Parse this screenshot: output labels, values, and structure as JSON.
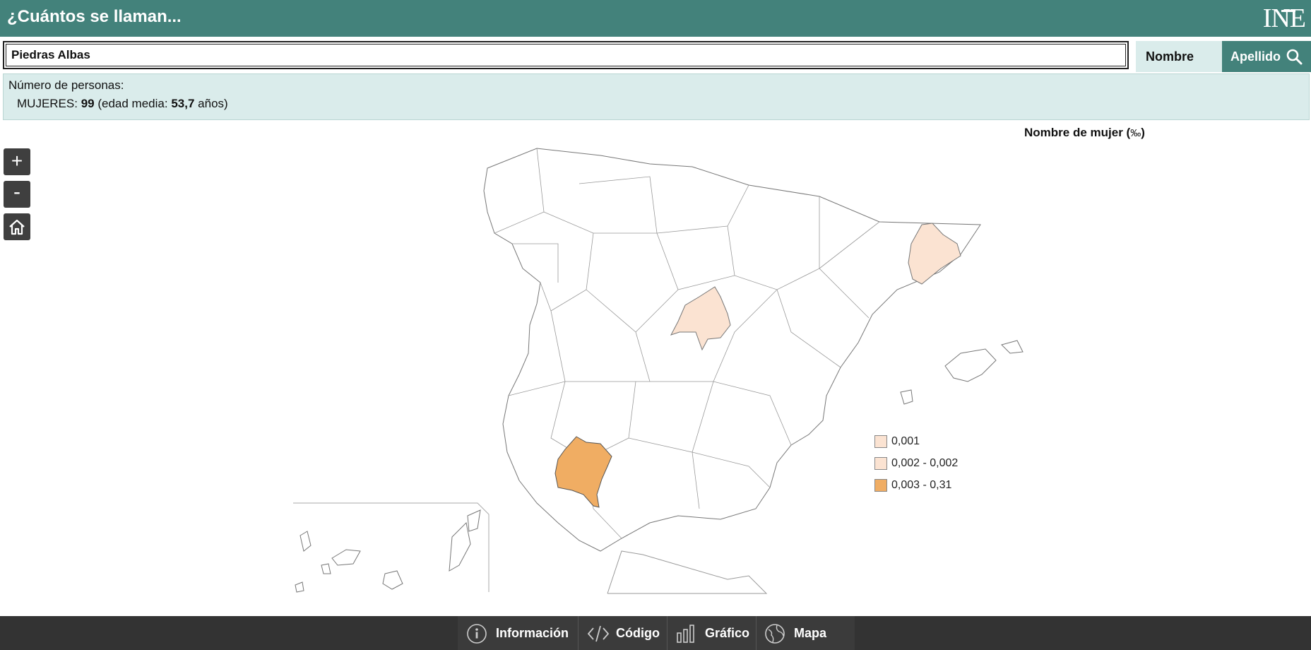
{
  "header": {
    "title": "¿Cuántos se llaman...",
    "logo_text": "INE"
  },
  "search": {
    "value": "Piedras Albas",
    "btn_nombre": "Nombre",
    "btn_apellido": "Apellido"
  },
  "result": {
    "label": "Número de personas:",
    "women_label": "MUJERES:",
    "women_count": "99",
    "avg_age_prefix": "(edad media:",
    "avg_age": "53,7",
    "avg_age_suffix": "años)"
  },
  "map": {
    "title": "Nombre de mujer (",
    "title_unit": "‰",
    "title_close": ")",
    "highlighted": [
      {
        "name": "Barcelona",
        "color": "#fbe3d2"
      },
      {
        "name": "Madrid",
        "color": "#fbe3d2"
      },
      {
        "name": "Huelva",
        "color": "#f0ad63"
      }
    ]
  },
  "legend": [
    {
      "label": "0,001",
      "color": "#fbe3d2"
    },
    {
      "label": "0,002 - 0,002",
      "color": "#fbe3d2"
    },
    {
      "label": "0,003 - 0,31",
      "color": "#f0ad63"
    }
  ],
  "zoom": {
    "in_label": "+",
    "out_label": "-",
    "home_icon": "home-icon"
  },
  "footer": {
    "items": [
      {
        "label": "Información",
        "icon": "info-icon"
      },
      {
        "label": "Código",
        "icon": "code-icon"
      },
      {
        "label": "Gráfico",
        "icon": "bar-chart-icon"
      },
      {
        "label": "Mapa",
        "icon": "globe-icon"
      }
    ]
  },
  "colors": {
    "header_bg": "#43827b",
    "info_bg": "#daeceb",
    "footer_bg": "#333333"
  }
}
